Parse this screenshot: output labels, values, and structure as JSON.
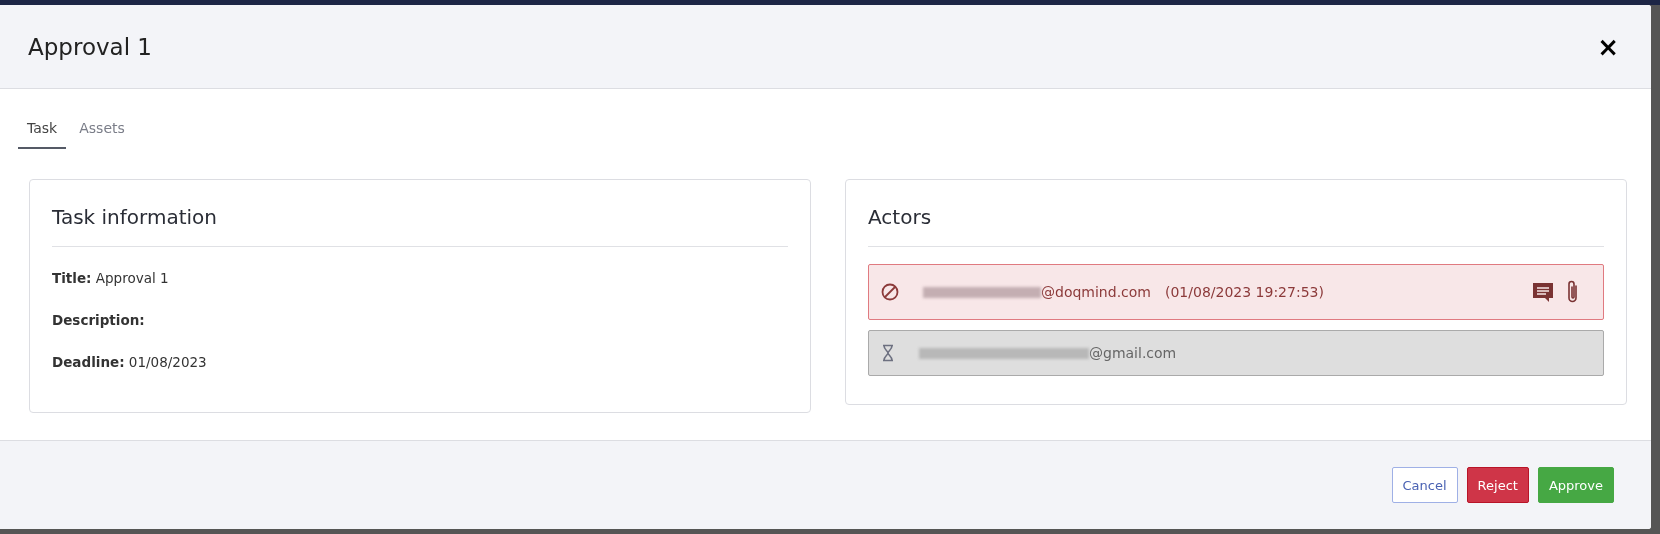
{
  "dialog": {
    "title": "Approval 1",
    "close": "×"
  },
  "tabs": [
    {
      "label": "Task",
      "selected": true
    },
    {
      "label": "Assets",
      "selected": false
    }
  ],
  "task_information": {
    "title": "Task information",
    "fields": [
      {
        "label": "Title:",
        "value": "Approval 1"
      },
      {
        "label": "Description:"
      },
      {
        "label": "Deadline:",
        "value": "01/08/2023"
      }
    ]
  },
  "actors": {
    "title": "Actors",
    "items": [
      {
        "kind": "rejected",
        "email_domain": "@doqmind.com",
        "timestamp": "(01/08/2023 19:27:53)",
        "has_comment": true,
        "has_attachment": true
      },
      {
        "kind": "pending",
        "email_domain": "@gmail.com",
        "has_comment": false,
        "has_attachment": false
      }
    ]
  },
  "buttons": [
    {
      "kind": "cancel",
      "label": "Cancel"
    },
    {
      "kind": "reject",
      "label": "Reject"
    },
    {
      "kind": "approve",
      "label": "Approve"
    }
  ]
}
